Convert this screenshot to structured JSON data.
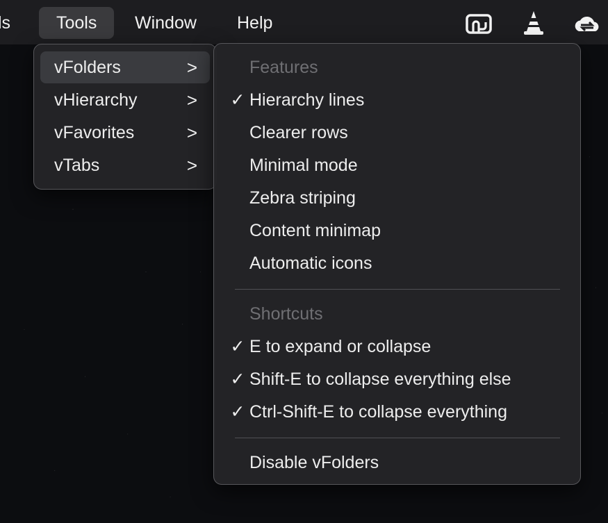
{
  "menubar": {
    "partial_label": "ls",
    "tools_label": "Tools",
    "window_label": "Window",
    "help_label": "Help",
    "icons": [
      "screen-share-icon",
      "vlc-cone-icon",
      "cloud-sync-icon"
    ]
  },
  "tools_menu": {
    "items": [
      {
        "label": "vFolders",
        "arrow": ">",
        "highlighted": true
      },
      {
        "label": "vHierarchy",
        "arrow": ">"
      },
      {
        "label": "vFavorites",
        "arrow": ">"
      },
      {
        "label": "vTabs",
        "arrow": ">"
      }
    ]
  },
  "submenu": {
    "features_header": "Features",
    "features": [
      {
        "label": "Hierarchy lines",
        "checked": true,
        "check": "✓"
      },
      {
        "label": "Clearer rows",
        "checked": false
      },
      {
        "label": "Minimal mode",
        "checked": false
      },
      {
        "label": "Zebra striping",
        "checked": false
      },
      {
        "label": "Content minimap",
        "checked": false
      },
      {
        "label": "Automatic icons",
        "checked": false
      }
    ],
    "shortcuts_header": "Shortcuts",
    "shortcuts": [
      {
        "label": "E to expand or collapse",
        "checked": true,
        "check": "✓"
      },
      {
        "label": "Shift-E to collapse everything else",
        "checked": true,
        "check": "✓"
      },
      {
        "label": "Ctrl-Shift-E to collapse everything",
        "checked": true,
        "check": "✓"
      }
    ],
    "disable_label": "Disable vFolders"
  }
}
